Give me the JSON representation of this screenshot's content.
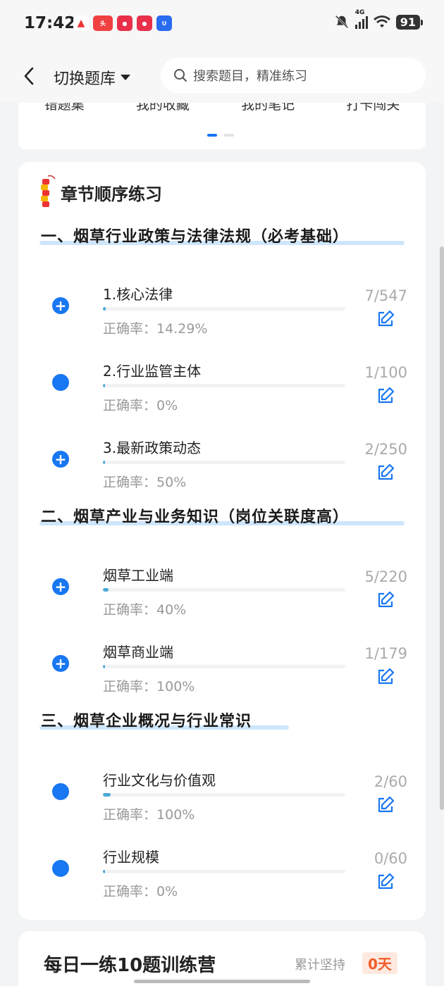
{
  "status_bar": {
    "time": "17:42",
    "network": "4G",
    "battery": "91"
  },
  "header": {
    "switch_label": "切换题库",
    "search_placeholder": "搜索题目，精准练习"
  },
  "top_card": {
    "items": [
      "错题集",
      "我的收藏",
      "我的笔记",
      "打卡闯关"
    ]
  },
  "practice": {
    "title": "章节顺序练习",
    "accuracy_prefix": "正确率：",
    "sections": [
      {
        "title": "一、烟草行业政策与法律法规（必考基础）",
        "items": [
          {
            "name": "1.核心法律",
            "accuracy": "14.29%",
            "count": "7/547",
            "progress": 0.013,
            "icon": "plus"
          },
          {
            "name": "2.行业监管主体",
            "accuracy": "0%",
            "count": "1/100",
            "progress": 0.01,
            "icon": "dot"
          },
          {
            "name": "3.最新政策动态",
            "accuracy": "50%",
            "count": "2/250",
            "progress": 0.008,
            "icon": "plus"
          }
        ]
      },
      {
        "title": "二、烟草产业与业务知识（岗位关联度高）",
        "items": [
          {
            "name": "烟草工业端",
            "accuracy": "40%",
            "count": "5/220",
            "progress": 0.023,
            "icon": "plus"
          },
          {
            "name": "烟草商业端",
            "accuracy": "100%",
            "count": "1/179",
            "progress": 0.006,
            "icon": "plus"
          }
        ]
      },
      {
        "title": "三、烟草企业概况与行业常识",
        "items": [
          {
            "name": "行业文化与价值观",
            "accuracy": "100%",
            "count": "2/60",
            "progress": 0.033,
            "icon": "dot"
          },
          {
            "name": "行业规模",
            "accuracy": "0%",
            "count": "0/60",
            "progress": 0,
            "icon": "dot"
          }
        ]
      }
    ]
  },
  "camp": {
    "title": "每日一练10题训练营",
    "streak_label": "累计坚持",
    "streak_value": "0天"
  },
  "colors": {
    "accent": "#1877f2",
    "progress": "#4aa8d8",
    "streak": "#f25c28"
  }
}
